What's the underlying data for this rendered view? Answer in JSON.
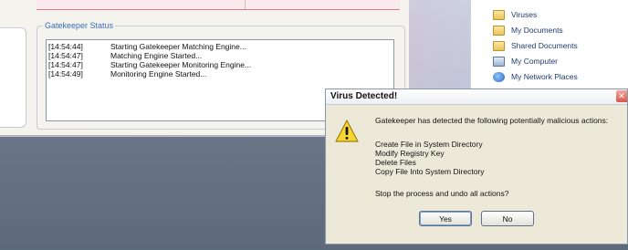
{
  "gatekeeper": {
    "group_title": "Gatekeeper Status",
    "log": [
      {
        "time": "[14:54:44]",
        "message": "Starting Gatekeeper Matching Engine..."
      },
      {
        "time": "[14:54:47]",
        "message": "Matching Engine Started..."
      },
      {
        "time": "[14:54:47]",
        "message": "Starting Gatekeeper Monitoring Engine..."
      },
      {
        "time": "[14:54:49]",
        "message": "Monitoring Engine Started..."
      }
    ]
  },
  "explorer": {
    "items": [
      {
        "label": "Viruses",
        "icon": "folder-icon"
      },
      {
        "label": "My Documents",
        "icon": "documents-folder-icon"
      },
      {
        "label": "Shared Documents",
        "icon": "shared-folder-icon"
      },
      {
        "label": "My Computer",
        "icon": "computer-icon"
      },
      {
        "label": "My Network Places",
        "icon": "network-places-icon"
      }
    ]
  },
  "dialog": {
    "title": "Virus Detected!",
    "close_label": "✕",
    "message": "Gatekeeper has detected the following potentially malicious actions:",
    "actions": [
      "Create File in System Directory",
      "Modify Registry Key",
      "Delete Files",
      "Copy File Into System Directory"
    ],
    "question": "Stop the process and undo all actions?",
    "yes_label": "Yes",
    "no_label": "No"
  }
}
